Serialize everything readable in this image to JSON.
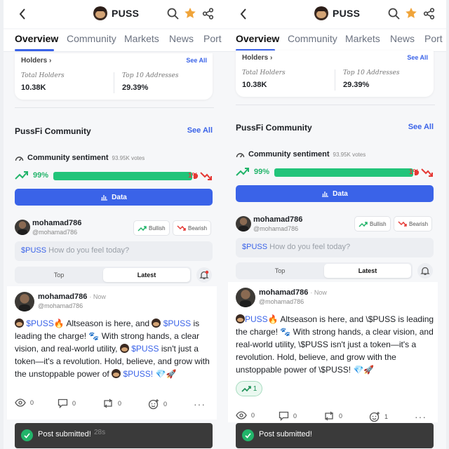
{
  "header": {
    "token": "PUSS"
  },
  "tabs": [
    "Overview",
    "Community",
    "Markets",
    "News",
    "Port"
  ],
  "holders": {
    "title": "Holders",
    "see_all": "See All",
    "total_label": "Total Holders",
    "total_value": "10.38K",
    "top_label": "Top 10 Addresses",
    "top_value": "29.39%"
  },
  "community": {
    "title": "PussFi Community",
    "see_all": "See All",
    "sentiment_label": "Community sentiment",
    "votes": "93.95K votes",
    "bullish_pct": "99%",
    "bearish_pct": "1%",
    "bullish_fraction": 0.99,
    "data_button": "Data"
  },
  "composer": {
    "username": "mohamad786",
    "handle": "@mohamad786",
    "bullish": "Bullish",
    "bearish": "Bearish",
    "ticker": "$PUSS",
    "placeholder": "How do you feel today?"
  },
  "filter": {
    "top": "Top",
    "latest": "Latest"
  },
  "left_post": {
    "username": "mohamad786",
    "time": "· Now",
    "handle": "@mohamad786",
    "t1": "$PUSS",
    "t2": " Altseason is here, and ",
    "t3": "$PUSS",
    "t4": " is leading the charge! ",
    "t5": " With strong hands, a clear vision, and real-world utility, ",
    "t6": "$PUSS",
    "t7": " isn't just a token—it's a revolution. Hold, believe, and grow with the unstoppable power of ",
    "t8": "$PUSS!",
    "views": "0",
    "comments": "0",
    "reposts": "0",
    "reactions": "0"
  },
  "right_post": {
    "username": "mohamad786",
    "time": "· Now",
    "handle": "@mohamad786",
    "t1": " Altseason is here, and \\$PUSS is leading the charge! ",
    "t2": " With strong hands, a clear vision, and real-world utility, \\$PUSS isn't just a token—it's a revolution. Hold, believe, and grow with the unstoppable power of \\$PUSS! ",
    "bull_count": "1",
    "views": "0",
    "comments": "0",
    "reposts": "0",
    "reactions": "1"
  },
  "toast": {
    "message": "Post submitted!",
    "ghost": "28s"
  },
  "colors": {
    "accent": "#3a63e8",
    "bull": "#22c47a",
    "bear": "#e53935"
  }
}
